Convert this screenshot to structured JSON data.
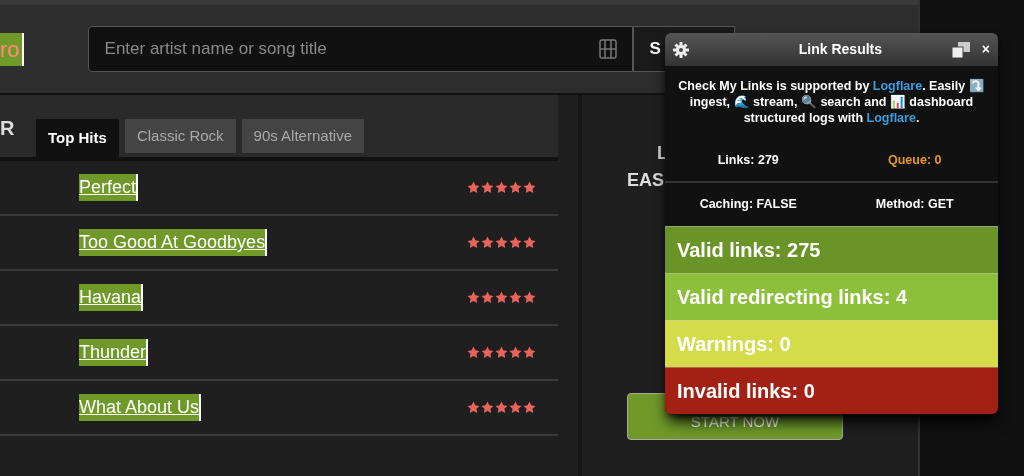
{
  "header": {
    "logo": "ro",
    "search": {
      "placeholder": "Enter artist name or song title"
    },
    "search_button": "S"
  },
  "chart_heading": "R",
  "tabs": [
    {
      "label": "Top Hits",
      "selected": true
    },
    {
      "label": "Classic Rock",
      "selected": false
    },
    {
      "label": "90s Alternative",
      "selected": false
    }
  ],
  "songs": [
    {
      "title": "Perfect",
      "stars": 5,
      "highlighted": true
    },
    {
      "title": "Too Good At Goodbyes",
      "stars": 5,
      "highlighted": true
    },
    {
      "title": "Havana",
      "stars": 5,
      "highlighted": true
    },
    {
      "title": "Thunder",
      "stars": 5,
      "highlighted": true
    },
    {
      "title": "What About Us",
      "stars": 5,
      "highlighted": true
    }
  ],
  "promo": {
    "line_1": "L",
    "line_2": "EAS",
    "button": "START NOW"
  },
  "link_results": {
    "title": "Link Results",
    "close": "×",
    "sponsor": [
      {
        "kind": "text",
        "text": "Check My Links is supported by "
      },
      {
        "kind": "link",
        "text": "Logflare"
      },
      {
        "kind": "text",
        "text": ". Easily ⤵️ ingest, 🌊 stream, 🔍 search and 📊 dashboard structured logs with "
      },
      {
        "kind": "link",
        "text": "Logflare"
      },
      {
        "kind": "text",
        "text": "."
      }
    ],
    "stats": [
      {
        "text": "Links: 279",
        "kind": "plain"
      },
      {
        "text": "Queue: 0",
        "kind": "queue"
      },
      {
        "text": "Caching: FALSE",
        "kind": "plain"
      },
      {
        "text": "Method: GET",
        "kind": "plain"
      }
    ],
    "results": [
      {
        "text": "Valid links: 275",
        "kind": "valid"
      },
      {
        "text": "Valid redirecting links: 4",
        "kind": "redirect"
      },
      {
        "text": "Warnings: 0",
        "kind": "warning"
      },
      {
        "text": "Invalid links: 0",
        "kind": "invalid"
      }
    ]
  }
}
